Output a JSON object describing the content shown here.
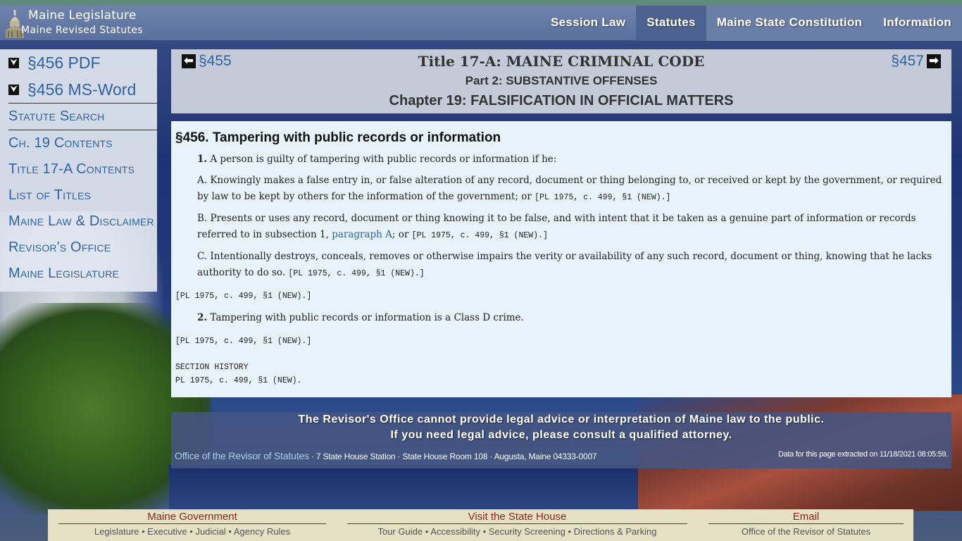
{
  "header": {
    "title": "Maine Legislature",
    "subtitle": "Maine Revised Statutes",
    "nav": [
      {
        "label": "Session Law"
      },
      {
        "label": "Statutes"
      },
      {
        "label": "Maine State Constitution"
      },
      {
        "label": "Information"
      }
    ]
  },
  "sidebar": {
    "downloads": [
      {
        "label": "§456 PDF"
      },
      {
        "label": "§456 MS-Word"
      }
    ],
    "links": [
      {
        "label": "Statute Search"
      },
      {
        "label": "Ch. 19 Contents"
      },
      {
        "label": "Title 17-A Contents"
      },
      {
        "label": "List of Titles"
      },
      {
        "label": "Maine Law & Disclaimer"
      },
      {
        "label": "Revisor's Office"
      },
      {
        "label": "Maine Legislature"
      }
    ]
  },
  "title_panel": {
    "prev": "§455",
    "next": "§457",
    "title": "Title 17-A: MAINE CRIMINAL CODE",
    "part": "Part 2: SUBSTANTIVE OFFENSES",
    "chapter": "Chapter 19: FALSIFICATION IN OFFICIAL MATTERS"
  },
  "content": {
    "heading": "§456. Tampering with public records or information",
    "sub1_num": "1.",
    "sub1_text": "A person is guilty of tampering with public records or information if he:",
    "a_text": "A. Knowingly makes a false entry in, or false alteration of any record, document or thing belonging to, or received or kept by the government, or required by law to be kept by others for the information of the government; or",
    "a_cite": "[PL 1975, c. 499, §1 (NEW).]",
    "b_text": "B. Presents or uses any record, document or thing knowing it to be false, and with intent that it be taken as a genuine part of information or records referred to in subsection 1,",
    "b_link": "paragraph A",
    "b_after": "; or",
    "b_cite": "[PL 1975, c. 499, §1 (NEW).]",
    "c_text": "C. Intentionally destroys, conceals, removes or otherwise impairs the verity or availability of any such record, document or thing, knowing that he lacks authority to do so.",
    "c_cite": "[PL 1975, c. 499, §1 (NEW).]",
    "sub1_cite": "[PL 1975, c. 499, §1 (NEW).]",
    "sub2_num": "2.",
    "sub2_text": "Tampering with public records or information is a Class D crime.",
    "sub2_cite": "[PL 1975, c. 499, §1 (NEW).]",
    "history_label": "SECTION HISTORY",
    "history_text": "PL 1975, c. 499, §1 (NEW)."
  },
  "disclaimer": {
    "line1": "The Revisor's Office cannot provide legal advice or interpretation of Maine law to the public.",
    "line2": "If you need legal advice, please consult a qualified attorney.",
    "office_link": "Office of the Revisor of Statutes",
    "office_address": " · 7 State House Station · State House Room 108 · Augusta, Maine 04333-0007",
    "extracted": "Data for this page extracted on 11/18/2021 08:05:59."
  },
  "bottom": {
    "col1_head": "Maine Government",
    "col1_links": [
      "Legislature",
      "Executive",
      "Judicial",
      "Agency Rules"
    ],
    "col2_head": "Visit the State House",
    "col2_links": [
      "Tour Guide",
      "Accessibility",
      "Security Screening",
      "Directions & Parking"
    ],
    "col3_head": "Email",
    "col3_links": [
      "Office of the Revisor of Statutes"
    ],
    "separator": " • "
  }
}
